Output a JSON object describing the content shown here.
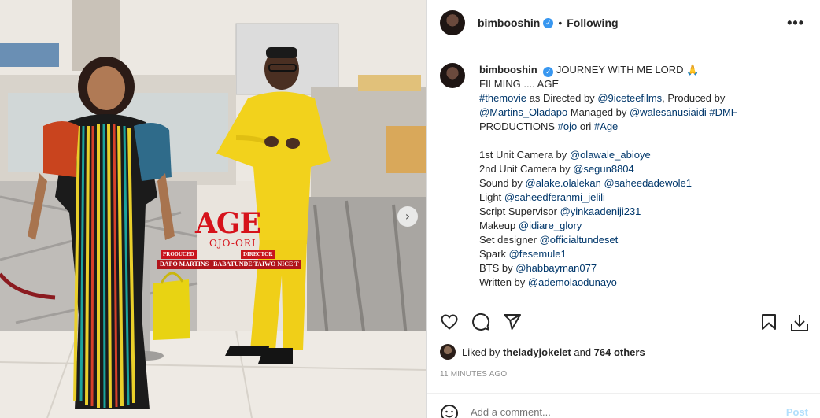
{
  "post": {
    "username": "bimbooshin",
    "follow_status": "Following",
    "separator": "•",
    "more_label": "•••"
  },
  "photo": {
    "poster_title": "AGE",
    "poster_subtitle": "OJO-ORI",
    "produced_label": "PRODUCED",
    "director_label": "DIRECTOR",
    "producer_name": "DAPO MARTINS",
    "director_name": "BABATUNDE TAIWO NICE T",
    "next_icon": "chevron-right-icon"
  },
  "caption": {
    "username": "bimbooshin",
    "line1": "JOURNEY WITH ME LORD 🙏",
    "line2": "FILMING .... AGE",
    "l3_tag": "#themovie",
    "l3_text": " as Directed by ",
    "l3_mention": "@9iceteefilms",
    "l3_tail": ", Produced by",
    "l4_mention": "@Martins_Oladapo",
    "l4_text": " Managed by ",
    "l4_mention2": "@walesanusiaidi",
    "l4_tag": " #DMF",
    "l5_text": "PRODUCTIONS ",
    "l5_tag": "#ojo",
    "l5_text2": " ori ",
    "l5_tag2": "#Age",
    "credits": [
      {
        "label": "1st Unit Camera by ",
        "mention": "@olawale_abioye",
        "extra": ""
      },
      {
        "label": "2nd Unit Camera by ",
        "mention": "@segun8804",
        "extra": ""
      },
      {
        "label": "Sound by ",
        "mention": "@alake.olalekan",
        "extra": " @saheedadewole1"
      },
      {
        "label": "Light ",
        "mention": "@saheedferanmi_jelili",
        "extra": ""
      },
      {
        "label": "Script Supervisor ",
        "mention": "@yinkaadeniji231",
        "extra": ""
      },
      {
        "label": "Makeup ",
        "mention": "@idiare_glory",
        "extra": ""
      },
      {
        "label": "Set designer ",
        "mention": "@officialtundeset",
        "extra": ""
      },
      {
        "label": "Spark ",
        "mention": "@fesemule1",
        "extra": ""
      },
      {
        "label": "BTS by ",
        "mention": "@habbayman077",
        "extra": ""
      },
      {
        "label": "Written by ",
        "mention": "@ademolaodunayo",
        "extra": ""
      }
    ]
  },
  "actions": {
    "icons": [
      "heart-icon",
      "comment-icon",
      "share-icon",
      "bookmark-icon",
      "download-icon"
    ]
  },
  "likes": {
    "prefix": "Liked by ",
    "user": "theladyjokelet",
    "middle": " and ",
    "others": "764 others"
  },
  "time_ago": "11 MINUTES AGO",
  "comment": {
    "placeholder": "Add a comment...",
    "post_label": "Post"
  },
  "colors": {
    "link": "#00376b",
    "verified": "#3897f0",
    "poster_red": "#d6121b",
    "post_button": "#b2dffc"
  }
}
